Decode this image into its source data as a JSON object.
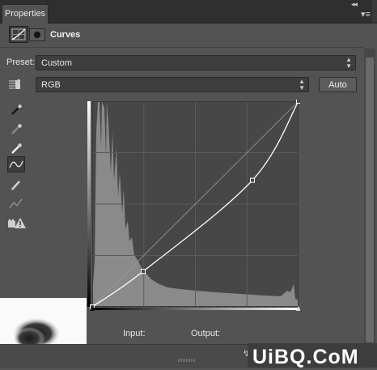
{
  "panel": {
    "tab_label": "Properties",
    "title": "Curves",
    "arrows": "◂◂",
    "menu": "▾≡"
  },
  "preset": {
    "label": "Preset:",
    "value": "Custom"
  },
  "channel": {
    "value": "RGB"
  },
  "auto_button": {
    "label": "Auto"
  },
  "tools": [
    {
      "name": "on-image-adjust",
      "icon": "hand-target-icon",
      "active": false
    },
    {
      "name": "black-point",
      "icon": "eyedropper-icon",
      "active": false
    },
    {
      "name": "gray-point",
      "icon": "eyedropper-icon",
      "active": false
    },
    {
      "name": "white-point",
      "icon": "eyedropper-icon",
      "active": false
    },
    {
      "name": "edit-points",
      "icon": "curve-icon",
      "active": true
    },
    {
      "name": "draw",
      "icon": "pencil-icon",
      "active": false
    },
    {
      "name": "smooth",
      "icon": "smooth-icon",
      "active": false
    },
    {
      "name": "clipping",
      "icon": "clipping-warning-icon",
      "active": false
    }
  ],
  "readout": {
    "input_label": "Input:",
    "output_label": "Output:"
  },
  "watermark": {
    "text": "UiBQ.CoM"
  },
  "curve": {
    "points": [
      [
        0,
        0
      ],
      [
        63,
        44
      ],
      [
        198,
        157
      ],
      [
        255,
        255
      ]
    ],
    "range": [
      0,
      255
    ]
  },
  "colors": {
    "panel_bg": "#535353",
    "graph_bg": "#474747",
    "histogram": "#8a8a8a",
    "curve": "#ffffff"
  }
}
